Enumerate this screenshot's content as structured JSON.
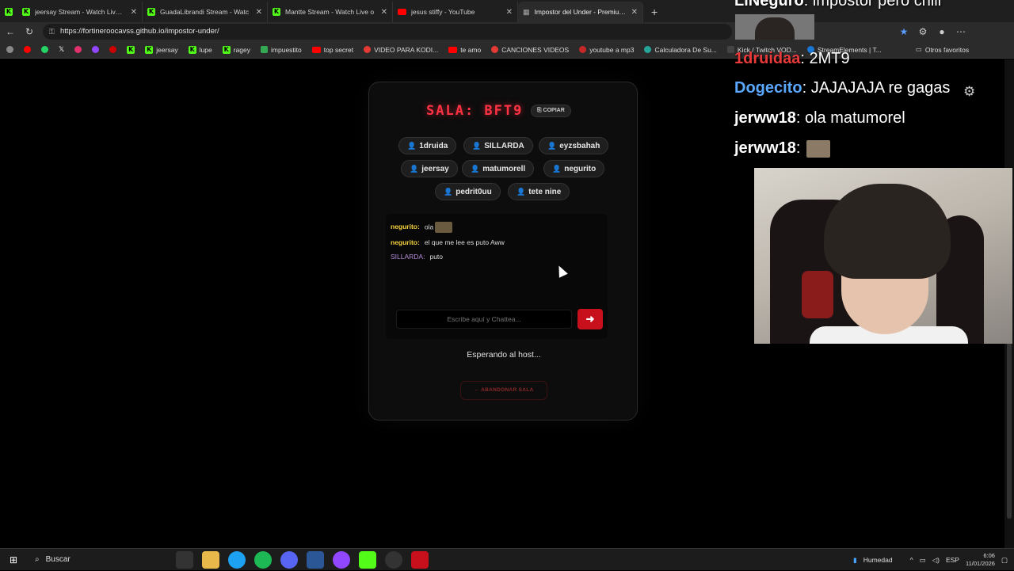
{
  "tabs": [
    {
      "title": "jeersay Stream - Watch Live on Ki",
      "icon": "kick"
    },
    {
      "title": "GuadaLibrandi Stream - Watc",
      "icon": "kick"
    },
    {
      "title": "Mantte Stream - Watch Live o",
      "icon": "kick"
    },
    {
      "title": "jesus stiffy - YouTube",
      "icon": "youtube"
    },
    {
      "title": "Impostor del Under - Premium Be",
      "icon": "page"
    }
  ],
  "address": {
    "url": "https://fortineroocavss.github.io/impostor-under/"
  },
  "bookmarks": [
    "jeersay",
    "lupe",
    "ragey",
    "impuestito",
    "top secret",
    "VIDEO PARA KODI...",
    "te amo",
    "CANCIONES VIDEOS",
    "youtube a mp3",
    "Calculadora De Su...",
    "Kick / Twitch VOD...",
    "StreamElements | T...",
    "Otros favoritos"
  ],
  "room": {
    "title": "SALA: BFT9",
    "copy_label": "⎘ COPIAR",
    "players": [
      "1druida",
      "SILLARDA",
      "eyzsbahah",
      "jeersay",
      "matumorell",
      "negurito",
      "pedrit0uu",
      "tete nine"
    ],
    "chat": [
      {
        "user": "negurito:",
        "text": "ola",
        "color": "#f5d23c",
        "emoji": true
      },
      {
        "user": "negurito:",
        "text": "el que me lee es puto Aww",
        "color": "#f5d23c"
      },
      {
        "user": "SILLARDA:",
        "text": "puto",
        "color": "#b58bd8"
      }
    ],
    "input_placeholder": "Escribe aquí y Chattea...",
    "send_label": "➜",
    "waiting_text": "Esperando al host...",
    "leave_label": "← ABANDONAR SALA"
  },
  "stream_chat": [
    {
      "user": "LiNeguro",
      "text": "impostor pero chill",
      "color": "#ffffff"
    },
    {
      "user": "1druidaa",
      "text": "2MT9",
      "color": "#e83a3a"
    },
    {
      "user": "Dogecito",
      "text": "JAJAJAJA re gagas",
      "color": "#5aa8ff"
    },
    {
      "user": "jerww18",
      "text": "ola matumorel",
      "color": "#ffffff"
    },
    {
      "user": "jerww18",
      "text": "",
      "color": "#ffffff"
    }
  ],
  "taskbar": {
    "search_label": "Buscar",
    "weather": "Humedad",
    "lang": "ESP",
    "time": "6:06",
    "date": "11/01/2026"
  }
}
